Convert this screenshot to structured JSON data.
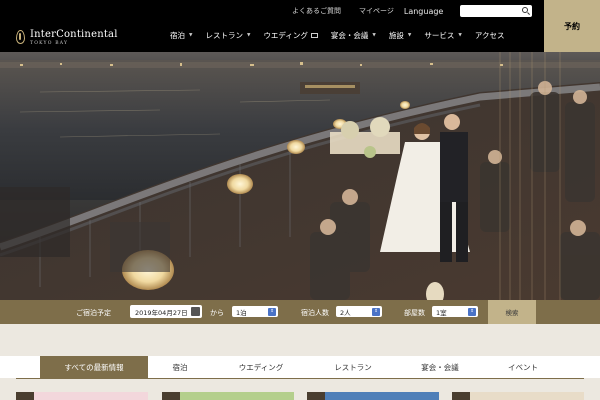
{
  "header": {
    "logo_name": "InterContinental",
    "logo_sub": "TOKYO BAY",
    "top_links": {
      "faq": "よくあるご質問",
      "mypage": "マイページ",
      "language": "Language"
    },
    "nav": [
      {
        "label": "宿泊",
        "has_menu": true
      },
      {
        "label": "レストラン",
        "has_menu": true
      },
      {
        "label": "ウエディング",
        "has_menu": false,
        "external": true
      },
      {
        "label": "宴会・会議",
        "has_menu": true
      },
      {
        "label": "施設",
        "has_menu": true
      },
      {
        "label": "サービス",
        "has_menu": true
      },
      {
        "label": "アクセス",
        "has_menu": false
      }
    ],
    "reserve_label": "予約"
  },
  "booking": {
    "label": "ご宿泊予定",
    "date": "2019年04月27日",
    "from": "から",
    "nights": "1泊",
    "guests_label": "宿泊人数",
    "guests": "2人",
    "rooms_label": "部屋数",
    "rooms": "1室",
    "search_label": "検索"
  },
  "tabs": [
    {
      "label": "すべての最新情報",
      "active": true
    },
    {
      "label": "宿泊",
      "active": false
    },
    {
      "label": "ウエディング",
      "active": false
    },
    {
      "label": "レストラン",
      "active": false
    },
    {
      "label": "宴会・会議",
      "active": false
    },
    {
      "label": "イベント",
      "active": false
    }
  ],
  "colors": {
    "header_bg": "#000000",
    "accent_gold": "#c2b38a",
    "booking_bar": "#7e6e4a",
    "page_bg": "#ece8e0"
  }
}
